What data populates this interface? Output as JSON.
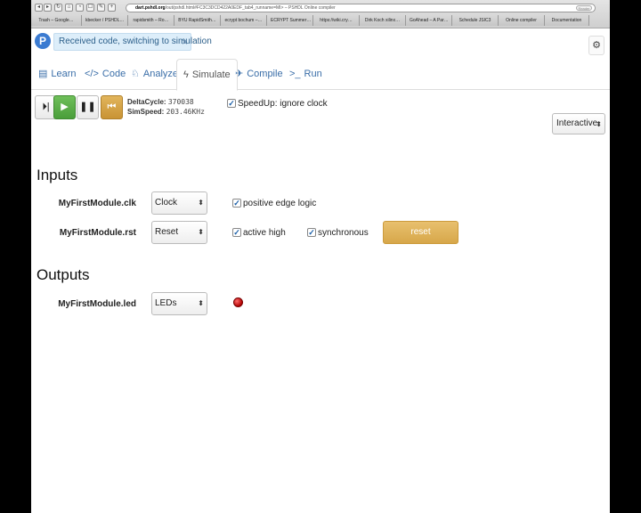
{
  "browser": {
    "url_host": "dart.pshdl.org",
    "url_rest": "/out/pshdl.html#FC3C3DCD422A0EDF_tab4_runname=MI> – PSHDL Online compiler",
    "reader_label": "Reader",
    "tabs": [
      "Trash – Google…",
      "kbecker / PSHDL…",
      "rapidsmith – Ro…",
      "BYU RapidSmith…",
      "ecrypt bochum –…",
      "ECRYPT Summer…",
      "https://wiki.cry…",
      "Dirk Koch xilinx…",
      "GoAhead – A Par…",
      "Schedule JSIC3",
      "Online compiler",
      "Documentation"
    ]
  },
  "app": {
    "logo_letter": "P",
    "notification": "Received code, switching to simulation",
    "notification_close": "×",
    "settings_icon": "⚙"
  },
  "nav": {
    "tabs": [
      {
        "icon": "▤",
        "label": "Learn"
      },
      {
        "icon": "</>",
        "label": "Code"
      },
      {
        "icon": "♘",
        "label": "Analyze"
      },
      {
        "icon": "ϟ",
        "label": "Simulate"
      },
      {
        "icon": "✈",
        "label": "Compile"
      },
      {
        "icon": ">_",
        "label": "Run"
      }
    ]
  },
  "sim": {
    "controls": {
      "step": "⏵|",
      "play": "▶",
      "pause": "❚❚",
      "rewind": "⏮"
    },
    "delta_label": "DeltaCycle:",
    "delta_value": "370038",
    "speed_label": "SimSpeed:",
    "speed_value": "203.46KHz",
    "speedup_label": "SpeedUp: ignore clock",
    "mode": "Interactive"
  },
  "inputs": {
    "title": "Inputs",
    "rows": [
      {
        "signal": "MyFirstModule.clk",
        "select": "Clock",
        "opt1": "positive edge logic"
      },
      {
        "signal": "MyFirstModule.rst",
        "select": "Reset",
        "opt1": "active high",
        "opt2": "synchronous",
        "button": "reset"
      }
    ]
  },
  "outputs": {
    "title": "Outputs",
    "rows": [
      {
        "signal": "MyFirstModule.led",
        "select": "LEDs"
      }
    ]
  },
  "colors": {
    "accent": "#3a6ea8",
    "play": "#4a9e3a",
    "warn": "#d7a74a",
    "led": "#c40000"
  }
}
